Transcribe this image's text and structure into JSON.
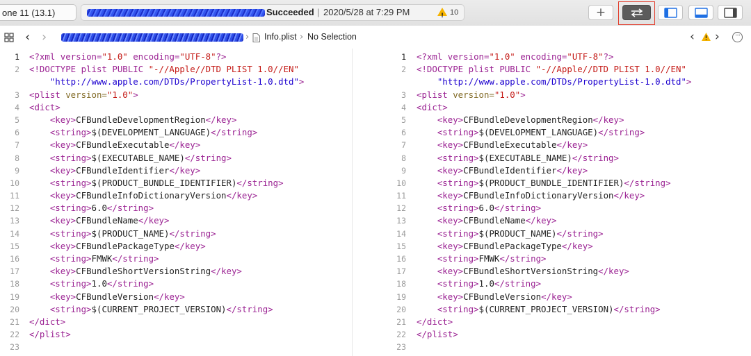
{
  "toolbar": {
    "scheme_label": "one 11 (13.1)",
    "status": {
      "label": "Succeeded",
      "separator": "|",
      "timestamp": "2020/5/28 at 7:29 PM",
      "warning_count": "10"
    },
    "add_button_label": "+",
    "compare_button_icon": "arrows-swap-icon",
    "panel_buttons": [
      "navigator-panel-icon",
      "debug-area-icon",
      "inspector-panel-icon"
    ],
    "highlight_color": "#e23d2c"
  },
  "jumpbar": {
    "back_label": "‹",
    "forward_label": "›",
    "file_name": "Info.plist",
    "chevron": "›",
    "selection": "No Selection",
    "issue_prev": "‹",
    "issue_next": "›",
    "more_label": "···"
  },
  "colors": {
    "processing_instruction": "#9b2393",
    "string": "#c41a16",
    "url": "#1c00cf",
    "tag": "#9b2393",
    "attribute": "#836c28",
    "text": "#1f1f1f"
  },
  "editors": {
    "left": {
      "current_line": 1,
      "lines": [
        {
          "num": "1",
          "parts": [
            {
              "c": "pi",
              "t": "<?xml "
            },
            {
              "c": "pi",
              "t": "version="
            },
            {
              "c": "str",
              "t": "\"1.0\""
            },
            {
              "c": "pi",
              "t": " encoding="
            },
            {
              "c": "str",
              "t": "\"UTF-8\""
            },
            {
              "c": "pi",
              "t": "?>"
            }
          ]
        },
        {
          "num": "2",
          "parts": [
            {
              "c": "pi",
              "t": "<!DOCTYPE plist PUBLIC "
            },
            {
              "c": "str",
              "t": "\"-//Apple//DTD PLIST 1.0//EN\""
            }
          ]
        },
        {
          "num": "",
          "parts": [
            {
              "c": "text",
              "t": "    "
            },
            {
              "c": "url",
              "t": "\"http://www.apple.com/DTDs/PropertyList-1.0.dtd\""
            },
            {
              "c": "pi",
              "t": ">"
            }
          ]
        },
        {
          "num": "3",
          "parts": [
            {
              "c": "tag",
              "t": "<plist "
            },
            {
              "c": "attr",
              "t": "version="
            },
            {
              "c": "str",
              "t": "\"1.0\""
            },
            {
              "c": "tag",
              "t": ">"
            }
          ]
        },
        {
          "num": "4",
          "parts": [
            {
              "c": "tag",
              "t": "<dict>"
            }
          ]
        },
        {
          "num": "5",
          "parts": [
            {
              "c": "text",
              "t": "    "
            },
            {
              "c": "tag",
              "t": "<key>"
            },
            {
              "c": "text",
              "t": "CFBundleDevelopmentRegion"
            },
            {
              "c": "tag",
              "t": "</key>"
            }
          ]
        },
        {
          "num": "6",
          "parts": [
            {
              "c": "text",
              "t": "    "
            },
            {
              "c": "tag",
              "t": "<string>"
            },
            {
              "c": "text",
              "t": "$(DEVELOPMENT_LANGUAGE)"
            },
            {
              "c": "tag",
              "t": "</string>"
            }
          ]
        },
        {
          "num": "7",
          "parts": [
            {
              "c": "text",
              "t": "    "
            },
            {
              "c": "tag",
              "t": "<key>"
            },
            {
              "c": "text",
              "t": "CFBundleExecutable"
            },
            {
              "c": "tag",
              "t": "</key>"
            }
          ]
        },
        {
          "num": "8",
          "parts": [
            {
              "c": "text",
              "t": "    "
            },
            {
              "c": "tag",
              "t": "<string>"
            },
            {
              "c": "text",
              "t": "$(EXECUTABLE_NAME)"
            },
            {
              "c": "tag",
              "t": "</string>"
            }
          ]
        },
        {
          "num": "9",
          "parts": [
            {
              "c": "text",
              "t": "    "
            },
            {
              "c": "tag",
              "t": "<key>"
            },
            {
              "c": "text",
              "t": "CFBundleIdentifier"
            },
            {
              "c": "tag",
              "t": "</key>"
            }
          ]
        },
        {
          "num": "10",
          "parts": [
            {
              "c": "text",
              "t": "    "
            },
            {
              "c": "tag",
              "t": "<string>"
            },
            {
              "c": "text",
              "t": "$(PRODUCT_BUNDLE_IDENTIFIER)"
            },
            {
              "c": "tag",
              "t": "</string>"
            }
          ]
        },
        {
          "num": "11",
          "parts": [
            {
              "c": "text",
              "t": "    "
            },
            {
              "c": "tag",
              "t": "<key>"
            },
            {
              "c": "text",
              "t": "CFBundleInfoDictionaryVersion"
            },
            {
              "c": "tag",
              "t": "</key>"
            }
          ]
        },
        {
          "num": "12",
          "parts": [
            {
              "c": "text",
              "t": "    "
            },
            {
              "c": "tag",
              "t": "<string>"
            },
            {
              "c": "text",
              "t": "6.0"
            },
            {
              "c": "tag",
              "t": "</string>"
            }
          ]
        },
        {
          "num": "13",
          "parts": [
            {
              "c": "text",
              "t": "    "
            },
            {
              "c": "tag",
              "t": "<key>"
            },
            {
              "c": "text",
              "t": "CFBundleName"
            },
            {
              "c": "tag",
              "t": "</key>"
            }
          ]
        },
        {
          "num": "14",
          "parts": [
            {
              "c": "text",
              "t": "    "
            },
            {
              "c": "tag",
              "t": "<string>"
            },
            {
              "c": "text",
              "t": "$(PRODUCT_NAME)"
            },
            {
              "c": "tag",
              "t": "</string>"
            }
          ]
        },
        {
          "num": "15",
          "parts": [
            {
              "c": "text",
              "t": "    "
            },
            {
              "c": "tag",
              "t": "<key>"
            },
            {
              "c": "text",
              "t": "CFBundlePackageType"
            },
            {
              "c": "tag",
              "t": "</key>"
            }
          ]
        },
        {
          "num": "16",
          "parts": [
            {
              "c": "text",
              "t": "    "
            },
            {
              "c": "tag",
              "t": "<string>"
            },
            {
              "c": "text",
              "t": "FMWK"
            },
            {
              "c": "tag",
              "t": "</string>"
            }
          ]
        },
        {
          "num": "17",
          "parts": [
            {
              "c": "text",
              "t": "    "
            },
            {
              "c": "tag",
              "t": "<key>"
            },
            {
              "c": "text",
              "t": "CFBundleShortVersionString"
            },
            {
              "c": "tag",
              "t": "</key>"
            }
          ]
        },
        {
          "num": "18",
          "parts": [
            {
              "c": "text",
              "t": "    "
            },
            {
              "c": "tag",
              "t": "<string>"
            },
            {
              "c": "text",
              "t": "1.0"
            },
            {
              "c": "tag",
              "t": "</string>"
            }
          ]
        },
        {
          "num": "19",
          "parts": [
            {
              "c": "text",
              "t": "    "
            },
            {
              "c": "tag",
              "t": "<key>"
            },
            {
              "c": "text",
              "t": "CFBundleVersion"
            },
            {
              "c": "tag",
              "t": "</key>"
            }
          ]
        },
        {
          "num": "20",
          "parts": [
            {
              "c": "text",
              "t": "    "
            },
            {
              "c": "tag",
              "t": "<string>"
            },
            {
              "c": "text",
              "t": "$(CURRENT_PROJECT_VERSION)"
            },
            {
              "c": "tag",
              "t": "</string>"
            }
          ]
        },
        {
          "num": "21",
          "parts": [
            {
              "c": "tag",
              "t": "</dict>"
            }
          ]
        },
        {
          "num": "22",
          "parts": [
            {
              "c": "tag",
              "t": "</plist>"
            }
          ]
        },
        {
          "num": "23",
          "parts": []
        }
      ]
    },
    "right": {
      "current_line": 1,
      "lines": [
        {
          "num": "1",
          "parts": [
            {
              "c": "pi",
              "t": "<?xml "
            },
            {
              "c": "pi",
              "t": "version="
            },
            {
              "c": "str",
              "t": "\"1.0\""
            },
            {
              "c": "pi",
              "t": " encoding="
            },
            {
              "c": "str",
              "t": "\"UTF-8\""
            },
            {
              "c": "pi",
              "t": "?>"
            }
          ]
        },
        {
          "num": "2",
          "parts": [
            {
              "c": "pi",
              "t": "<!DOCTYPE plist PUBLIC "
            },
            {
              "c": "str",
              "t": "\"-//Apple//DTD PLIST 1.0//EN\""
            }
          ]
        },
        {
          "num": "",
          "parts": [
            {
              "c": "text",
              "t": "    "
            },
            {
              "c": "url",
              "t": "\"http://www.apple.com/DTDs/PropertyList-1.0.dtd\""
            },
            {
              "c": "pi",
              "t": ">"
            }
          ]
        },
        {
          "num": "3",
          "parts": [
            {
              "c": "tag",
              "t": "<plist "
            },
            {
              "c": "attr",
              "t": "version="
            },
            {
              "c": "str",
              "t": "\"1.0\""
            },
            {
              "c": "tag",
              "t": ">"
            }
          ]
        },
        {
          "num": "4",
          "parts": [
            {
              "c": "tag",
              "t": "<dict>"
            }
          ]
        },
        {
          "num": "5",
          "parts": [
            {
              "c": "text",
              "t": "    "
            },
            {
              "c": "tag",
              "t": "<key>"
            },
            {
              "c": "text",
              "t": "CFBundleDevelopmentRegion"
            },
            {
              "c": "tag",
              "t": "</key>"
            }
          ]
        },
        {
          "num": "6",
          "parts": [
            {
              "c": "text",
              "t": "    "
            },
            {
              "c": "tag",
              "t": "<string>"
            },
            {
              "c": "text",
              "t": "$(DEVELOPMENT_LANGUAGE)"
            },
            {
              "c": "tag",
              "t": "</string>"
            }
          ]
        },
        {
          "num": "7",
          "parts": [
            {
              "c": "text",
              "t": "    "
            },
            {
              "c": "tag",
              "t": "<key>"
            },
            {
              "c": "text",
              "t": "CFBundleExecutable"
            },
            {
              "c": "tag",
              "t": "</key>"
            }
          ]
        },
        {
          "num": "8",
          "parts": [
            {
              "c": "text",
              "t": "    "
            },
            {
              "c": "tag",
              "t": "<string>"
            },
            {
              "c": "text",
              "t": "$(EXECUTABLE_NAME)"
            },
            {
              "c": "tag",
              "t": "</string>"
            }
          ]
        },
        {
          "num": "9",
          "parts": [
            {
              "c": "text",
              "t": "    "
            },
            {
              "c": "tag",
              "t": "<key>"
            },
            {
              "c": "text",
              "t": "CFBundleIdentifier"
            },
            {
              "c": "tag",
              "t": "</key>"
            }
          ]
        },
        {
          "num": "10",
          "parts": [
            {
              "c": "text",
              "t": "    "
            },
            {
              "c": "tag",
              "t": "<string>"
            },
            {
              "c": "text",
              "t": "$(PRODUCT_BUNDLE_IDENTIFIER)"
            },
            {
              "c": "tag",
              "t": "</string>"
            }
          ]
        },
        {
          "num": "11",
          "parts": [
            {
              "c": "text",
              "t": "    "
            },
            {
              "c": "tag",
              "t": "<key>"
            },
            {
              "c": "text",
              "t": "CFBundleInfoDictionaryVersion"
            },
            {
              "c": "tag",
              "t": "</key>"
            }
          ]
        },
        {
          "num": "12",
          "parts": [
            {
              "c": "text",
              "t": "    "
            },
            {
              "c": "tag",
              "t": "<string>"
            },
            {
              "c": "text",
              "t": "6.0"
            },
            {
              "c": "tag",
              "t": "</string>"
            }
          ]
        },
        {
          "num": "13",
          "parts": [
            {
              "c": "text",
              "t": "    "
            },
            {
              "c": "tag",
              "t": "<key>"
            },
            {
              "c": "text",
              "t": "CFBundleName"
            },
            {
              "c": "tag",
              "t": "</key>"
            }
          ]
        },
        {
          "num": "14",
          "parts": [
            {
              "c": "text",
              "t": "    "
            },
            {
              "c": "tag",
              "t": "<string>"
            },
            {
              "c": "text",
              "t": "$(PRODUCT_NAME)"
            },
            {
              "c": "tag",
              "t": "</string>"
            }
          ]
        },
        {
          "num": "15",
          "parts": [
            {
              "c": "text",
              "t": "    "
            },
            {
              "c": "tag",
              "t": "<key>"
            },
            {
              "c": "text",
              "t": "CFBundlePackageType"
            },
            {
              "c": "tag",
              "t": "</key>"
            }
          ]
        },
        {
          "num": "16",
          "parts": [
            {
              "c": "text",
              "t": "    "
            },
            {
              "c": "tag",
              "t": "<string>"
            },
            {
              "c": "text",
              "t": "FMWK"
            },
            {
              "c": "tag",
              "t": "</string>"
            }
          ]
        },
        {
          "num": "17",
          "parts": [
            {
              "c": "text",
              "t": "    "
            },
            {
              "c": "tag",
              "t": "<key>"
            },
            {
              "c": "text",
              "t": "CFBundleShortVersionString"
            },
            {
              "c": "tag",
              "t": "</key>"
            }
          ]
        },
        {
          "num": "18",
          "parts": [
            {
              "c": "text",
              "t": "    "
            },
            {
              "c": "tag",
              "t": "<string>"
            },
            {
              "c": "text",
              "t": "1.0"
            },
            {
              "c": "tag",
              "t": "</string>"
            }
          ]
        },
        {
          "num": "19",
          "parts": [
            {
              "c": "text",
              "t": "    "
            },
            {
              "c": "tag",
              "t": "<key>"
            },
            {
              "c": "text",
              "t": "CFBundleVersion"
            },
            {
              "c": "tag",
              "t": "</key>"
            }
          ]
        },
        {
          "num": "20",
          "parts": [
            {
              "c": "text",
              "t": "    "
            },
            {
              "c": "tag",
              "t": "<string>"
            },
            {
              "c": "text",
              "t": "$(CURRENT_PROJECT_VERSION)"
            },
            {
              "c": "tag",
              "t": "</string>"
            }
          ]
        },
        {
          "num": "21",
          "parts": [
            {
              "c": "tag",
              "t": "</dict>"
            }
          ]
        },
        {
          "num": "22",
          "parts": [
            {
              "c": "tag",
              "t": "</plist>"
            }
          ]
        },
        {
          "num": "23",
          "parts": []
        }
      ]
    }
  }
}
